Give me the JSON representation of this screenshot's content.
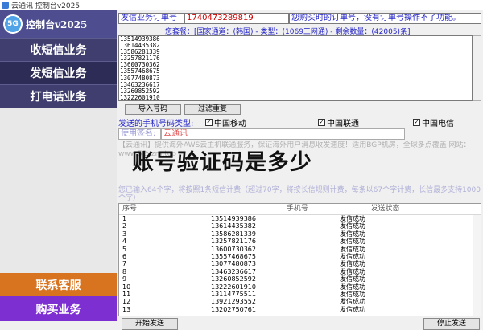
{
  "window": {
    "title": "云通讯 控制台v2025"
  },
  "logo": {
    "badge": "5G",
    "text": "控制台v2025"
  },
  "nav": [
    {
      "label": "收短信业务"
    },
    {
      "label": "发短信业务"
    },
    {
      "label": "打电话业务"
    }
  ],
  "contact_label": "联系客服",
  "buy_label": "购买业务",
  "order": {
    "label": "发信业务订单号",
    "value": "1740473289819",
    "hint": "您购买时的订单号，没有订单号操作不了功能。"
  },
  "package": {
    "text": "您套餐：[国家通道：(韩国) - 类型：(1069三网通) - 剩余数量：(42005)条]"
  },
  "phone_list": [
    "13514939386",
    "13614435382",
    "13586281339",
    "13257821176",
    "13600730362",
    "13557468675",
    "13077480873",
    "13463236617",
    "13260852592",
    "13222601910"
  ],
  "buttons": {
    "import": "导入号码",
    "dedupe": "过滤重复",
    "start": "开始发送",
    "stop": "停止发送"
  },
  "carrier": {
    "label": "发送的手机号码类型:",
    "options": [
      {
        "name": "中国移动",
        "checked": true
      },
      {
        "name": "中国联通",
        "checked": true
      },
      {
        "name": "中国电信",
        "checked": true
      }
    ]
  },
  "signature": {
    "label": "使用签名:",
    "value": "云通讯"
  },
  "notice_top": "【云通讯】提供海外AWS云主机联通服务，保证海外用户消息收发速度！适用BGP机房，全球多点覆盖 网站：www.52yzm.top",
  "headline": "账号验证码是多少",
  "notice_bottom": "您已输入64个字，将按照1条短信计费（超过70字，将按长信规则计费，每条以67个字计费，长信最多支持1000个字）",
  "table": {
    "headers": [
      "序号",
      "手机号",
      "发送状态"
    ],
    "rows": [
      [
        "1",
        "13514939386",
        "发信成功"
      ],
      [
        "2",
        "13614435382",
        "发信成功"
      ],
      [
        "3",
        "13586281339",
        "发信成功"
      ],
      [
        "4",
        "13257821176",
        "发信成功"
      ],
      [
        "5",
        "13600730362",
        "发信成功"
      ],
      [
        "6",
        "13557468675",
        "发信成功"
      ],
      [
        "7",
        "13077480873",
        "发信成功"
      ],
      [
        "8",
        "13463236617",
        "发信成功"
      ],
      [
        "9",
        "13260852592",
        "发信成功"
      ],
      [
        "10",
        "13222601910",
        "发信成功"
      ],
      [
        "11",
        "13114775511",
        "发信成功"
      ],
      [
        "12",
        "13921293552",
        "发信成功"
      ],
      [
        "13",
        "13202750761",
        "发信成功"
      ]
    ]
  }
}
